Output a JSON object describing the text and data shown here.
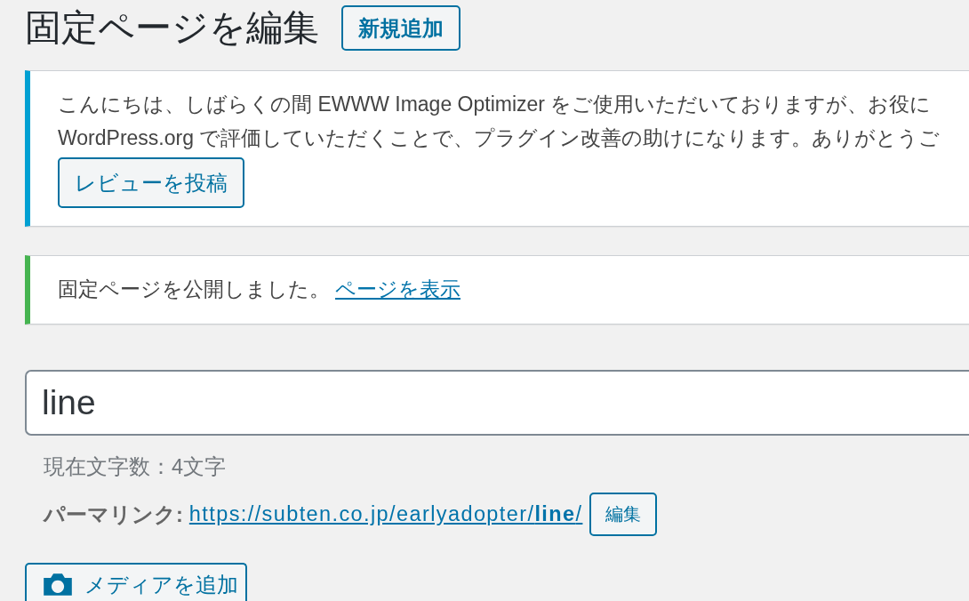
{
  "page_title": "固定ページを編集",
  "add_new_button": "新規追加",
  "notices": [
    {
      "kind": "info",
      "lines": [
        "こんにちは、しばらくの間 EWWW Image Optimizer をご使用いただいておりますが、お役に",
        "WordPress.org で評価していただくことで、プラグイン改善の助けになります。ありがとうご"
      ],
      "button": "レビューを投稿"
    },
    {
      "kind": "success",
      "lines": [
        "固定ページを公開しました。"
      ],
      "link": "ページを表示"
    }
  ],
  "title_field": {
    "value": "line"
  },
  "character_count": "現在文字数：4文字",
  "permalink": {
    "label": "パーマリンク:",
    "url": "https://subten.co.jp/earlyadopter/**line**/",
    "edit_button": "編集"
  },
  "media_button": "メディアを追加"
}
